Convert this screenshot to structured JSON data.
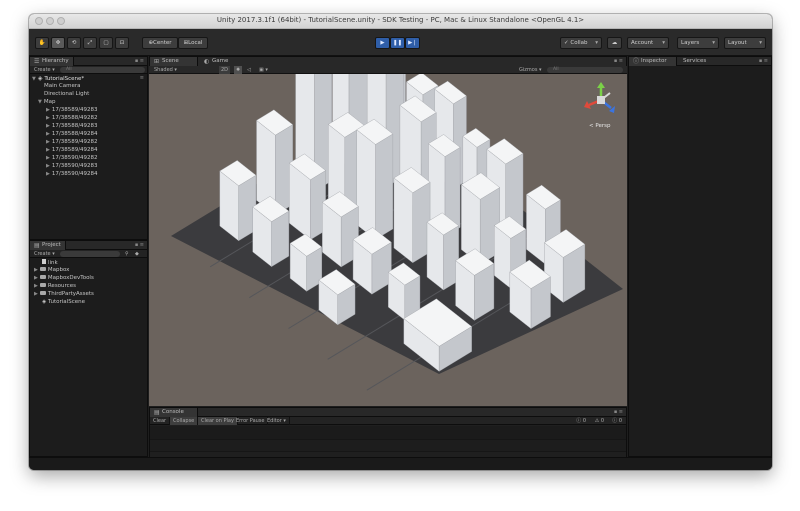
{
  "window": {
    "title": "Unity 2017.3.1f1 (64bit) - TutorialScene.unity - SDK Testing - PC, Mac & Linux Standalone <OpenGL 4.1>"
  },
  "toolbar": {
    "center_label": "Center",
    "local_label": "Local",
    "collab_label": "Collab",
    "account_label": "Account",
    "layers_label": "Layers",
    "layout_label": "Layout"
  },
  "hierarchy": {
    "tab_label": "Hierarchy",
    "create_label": "Create",
    "search_placeholder": "All",
    "scene_name": "TutorialScene*",
    "items": [
      {
        "label": "Main Camera"
      },
      {
        "label": "Directional Light"
      },
      {
        "label": "Map"
      }
    ],
    "map_children": [
      "17/38589/49283",
      "17/38588/49282",
      "17/38588/49283",
      "17/38588/49284",
      "17/38589/49282",
      "17/38589/49284",
      "17/38590/49282",
      "17/38590/49283",
      "17/38590/49284"
    ]
  },
  "project": {
    "tab_label": "Project",
    "create_label": "Create",
    "items": [
      {
        "label": "link",
        "kind": "file"
      },
      {
        "label": "Mapbox",
        "kind": "folder"
      },
      {
        "label": "MapboxDevTools",
        "kind": "folder"
      },
      {
        "label": "Resources",
        "kind": "folder"
      },
      {
        "label": "ThirdPartyAssets",
        "kind": "folder"
      },
      {
        "label": "TutorialScene",
        "kind": "scene"
      }
    ]
  },
  "scene": {
    "tab_label": "Scene",
    "game_tab_label": "Game",
    "shading_mode": "Shaded",
    "mode_2d": "2D",
    "gizmos_label": "Gizmos",
    "gizmos_search": "All",
    "projection_label": "< Persp"
  },
  "console": {
    "tab_label": "Console",
    "buttons": [
      "Clear",
      "Collapse",
      "Clear on Play",
      "Error Pause",
      "Editor"
    ],
    "info_count": "0",
    "warn_count": "0",
    "error_count": "0"
  },
  "inspector": {
    "tab_label": "Inspector",
    "services_tab_label": "Services"
  },
  "colors": {
    "editor_bg": "#1e1e1e",
    "scene_bg": "#6b635d",
    "play_accent": "#2f5ea8",
    "building": "#d9dce0",
    "road": "#3b3b3e"
  }
}
